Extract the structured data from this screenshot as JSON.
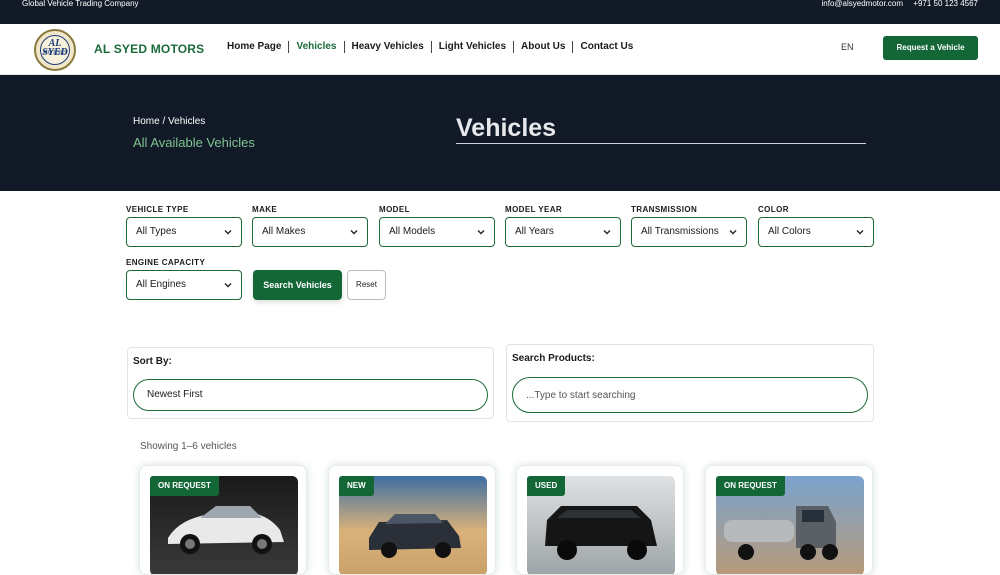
{
  "topbar": {
    "tagline": "Global Vehicle Trading Company",
    "email": "info@alsyedmotor.com",
    "phone": "+971 50 123 4567"
  },
  "nav": {
    "logo_line1": "AL SYED",
    "logo_line2": "MOTORS",
    "brand": "AL SYED MOTORS",
    "items": [
      "Home Page",
      "Vehicles",
      "Heavy Vehicles",
      "Light Vehicles",
      "About Us",
      "Contact Us"
    ],
    "active": "Vehicles",
    "lang": "EN",
    "request_label": "Request a Vehicle"
  },
  "hero": {
    "crumb_home": "Home",
    "crumb_sep": "/",
    "crumb_current": "Vehicles",
    "subtitle": "All Available Vehicles",
    "title": "Vehicles"
  },
  "filters": [
    {
      "label": "VEHICLE TYPE",
      "value": "All Types"
    },
    {
      "label": "MAKE",
      "value": "All Makes"
    },
    {
      "label": "MODEL",
      "value": "All Models"
    },
    {
      "label": "MODEL YEAR",
      "value": "All Years"
    },
    {
      "label": "TRANSMISSION",
      "value": "All Transmissions"
    },
    {
      "label": "COLOR",
      "value": "All Colors"
    },
    {
      "label": "ENGINE CAPACITY",
      "value": "All Engines"
    }
  ],
  "actions": {
    "search_label": "Search Vehicles",
    "reset_label": "Reset"
  },
  "sort": {
    "title": "Sort By:",
    "value": "Newest First"
  },
  "search": {
    "title": "Search Products:",
    "placeholder": "...Type to start searching"
  },
  "results": {
    "showing": "Showing 1–6 vehicles"
  },
  "cards": [
    {
      "badge": "ON REQUEST",
      "image": "white-suv"
    },
    {
      "badge": "NEW",
      "image": "dark-suv-sunset"
    },
    {
      "badge": "USED",
      "image": "black-suv-garage"
    },
    {
      "badge": "ON REQUEST",
      "image": "tanker-truck"
    }
  ],
  "colors": {
    "dark_navy": "#121a27",
    "brand_green": "#136737",
    "accent_green": "#7fc492"
  }
}
